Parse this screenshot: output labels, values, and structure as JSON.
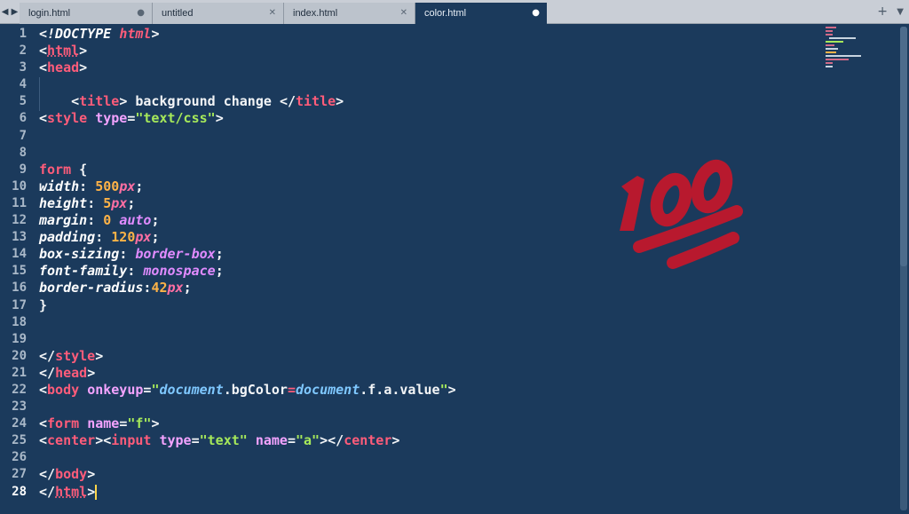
{
  "tabs": [
    {
      "label": "login.html",
      "close": "●"
    },
    {
      "label": "untitled",
      "close": "✕"
    },
    {
      "label": "index.html",
      "close": "✕"
    },
    {
      "label": "color.html",
      "close": "●"
    }
  ],
  "tabbar_icons": {
    "nav": "◀ ▶",
    "plus": "+",
    "menu": "▼"
  },
  "line_numbers": [
    "1",
    "2",
    "3",
    "4",
    "5",
    "6",
    "7",
    "8",
    "9",
    "10",
    "11",
    "12",
    "13",
    "14",
    "15",
    "16",
    "17",
    "18",
    "19",
    "20",
    "21",
    "22",
    "23",
    "24",
    "25",
    "26",
    "27",
    "28"
  ],
  "current_line": "28",
  "code": {
    "l1": {
      "lt": "<",
      "bang": "!DOCTYPE",
      "sp": " ",
      "html": "html",
      "gt": ">"
    },
    "l2": {
      "open": "<",
      "tag": "html",
      "close": ">"
    },
    "l3": {
      "open": "<",
      "tag": "head",
      "close": ">"
    },
    "l5": {
      "indent": "    ",
      "o1": "<",
      "t1": "title",
      "c1": ">",
      "text": " background change ",
      "o2": "</",
      "t2": "title",
      "c2": ">"
    },
    "l6": {
      "open": "<",
      "tag": "style",
      "sp": " ",
      "attr": "type",
      "eq": "=",
      "val": "\"text/css\"",
      "close": ">"
    },
    "l9": {
      "sel": "form",
      "brace": " {"
    },
    "l10": {
      "prop": "width",
      "colon": ": ",
      "num": "500",
      "unit": "px",
      "semi": ";"
    },
    "l11": {
      "prop": "height",
      "colon": ": ",
      "num": "5",
      "unit": "px",
      "semi": ";"
    },
    "l12": {
      "prop": "margin",
      "colon": ": ",
      "num": "0",
      "sp": " ",
      "val": "auto",
      "semi": ";"
    },
    "l13": {
      "prop": "padding",
      "colon": ": ",
      "num": "120",
      "unit": "px",
      "semi": ";"
    },
    "l14": {
      "prop": "box-sizing",
      "colon": ": ",
      "val": "border-box",
      "semi": ";"
    },
    "l15": {
      "prop": "font-family",
      "colon": ": ",
      "val": "monospace",
      "semi": ";"
    },
    "l16": {
      "prop": "border-radius",
      "colon": ":",
      "num": "42",
      "unit": "px",
      "semi": ";"
    },
    "l17": {
      "brace": "}"
    },
    "l20": {
      "open": "</",
      "tag": "style",
      "close": ">"
    },
    "l21": {
      "open": "</",
      "tag": "head",
      "close": ">"
    },
    "l22": {
      "open": "<",
      "tag": "body",
      "sp": " ",
      "attr": "onkeyup",
      "eq": "=",
      "q1": "\"",
      "obj1": "document",
      "mid": ".bgColor",
      "op": "=",
      "obj2": "document",
      "tail": ".f.a.value",
      "q2": "\"",
      "close": ">"
    },
    "l24": {
      "open": "<",
      "tag": "form",
      "sp": " ",
      "attr": "name",
      "eq": "=",
      "val": "\"f\"",
      "close": ">"
    },
    "l25": {
      "o1": "<",
      "t1": "center",
      "c1": ">",
      "o2": "<",
      "t2": "input",
      "sp1": " ",
      "a1": "type",
      "eq1": "=",
      "v1": "\"text\"",
      "sp2": " ",
      "a2": "name",
      "eq2": "=",
      "v2": "\"a\"",
      "c2": ">",
      "o3": "</",
      "t3": "center",
      "c3": ">"
    },
    "l27": {
      "open": "</",
      "tag": "body",
      "close": ">"
    },
    "l28": {
      "open": "</",
      "tag": "html",
      "close": ">"
    }
  },
  "emoji": {
    "name": "hundred-points",
    "color": "#b8192e"
  },
  "colors": {
    "background": "#1b3a5c",
    "tag": "#ff5c7a",
    "string": "#a6e95a",
    "number": "#ffb347",
    "caret": "#ffd54a"
  }
}
